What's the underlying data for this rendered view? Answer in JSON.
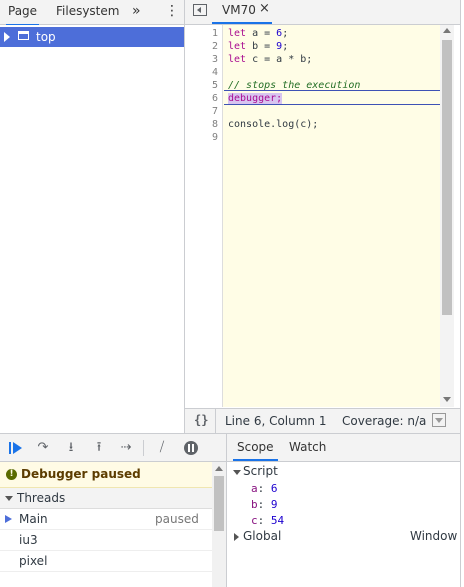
{
  "navigator": {
    "tabs": [
      "Page",
      "Filesystem"
    ],
    "more_label": "»",
    "menu_label": "⋮",
    "tree": {
      "label": "top"
    }
  },
  "editor": {
    "tab_label": "VM70",
    "close_label": "×",
    "line_numbers": [
      "1",
      "2",
      "3",
      "4",
      "5",
      "6",
      "7",
      "8",
      "9"
    ],
    "code": {
      "line1": {
        "kw": "let",
        "rest1": " a = ",
        "num": "6",
        "rest2": ";"
      },
      "line2": {
        "kw": "let",
        "rest1": " b = ",
        "num": "9",
        "rest2": ";"
      },
      "line3": {
        "kw": "let",
        "rest1": " c = a * b;"
      },
      "line5": "// stops the execution",
      "line6": "debugger;",
      "line8": "console.log(c);"
    },
    "status": {
      "braces": "{}",
      "position": "Line 6, Column 1",
      "coverage": "Coverage: n/a"
    }
  },
  "debugger": {
    "paused_message": "Debugger paused",
    "threads_header": "Threads",
    "threads": [
      {
        "name": "Main",
        "status": "paused"
      },
      {
        "name": "iu3",
        "status": ""
      },
      {
        "name": "pixel",
        "status": ""
      }
    ]
  },
  "scope": {
    "tabs": [
      "Scope",
      "Watch"
    ],
    "script_header": "Script",
    "vars": [
      {
        "name": "a",
        "value": "6"
      },
      {
        "name": "b",
        "value": "9"
      },
      {
        "name": "c",
        "value": "54"
      }
    ],
    "global_label": "Global",
    "global_value": "Window"
  },
  "colors": {
    "accent": "#1a73e8",
    "selection": "#4d6ed9",
    "paused_bg": "#fffbe5"
  }
}
